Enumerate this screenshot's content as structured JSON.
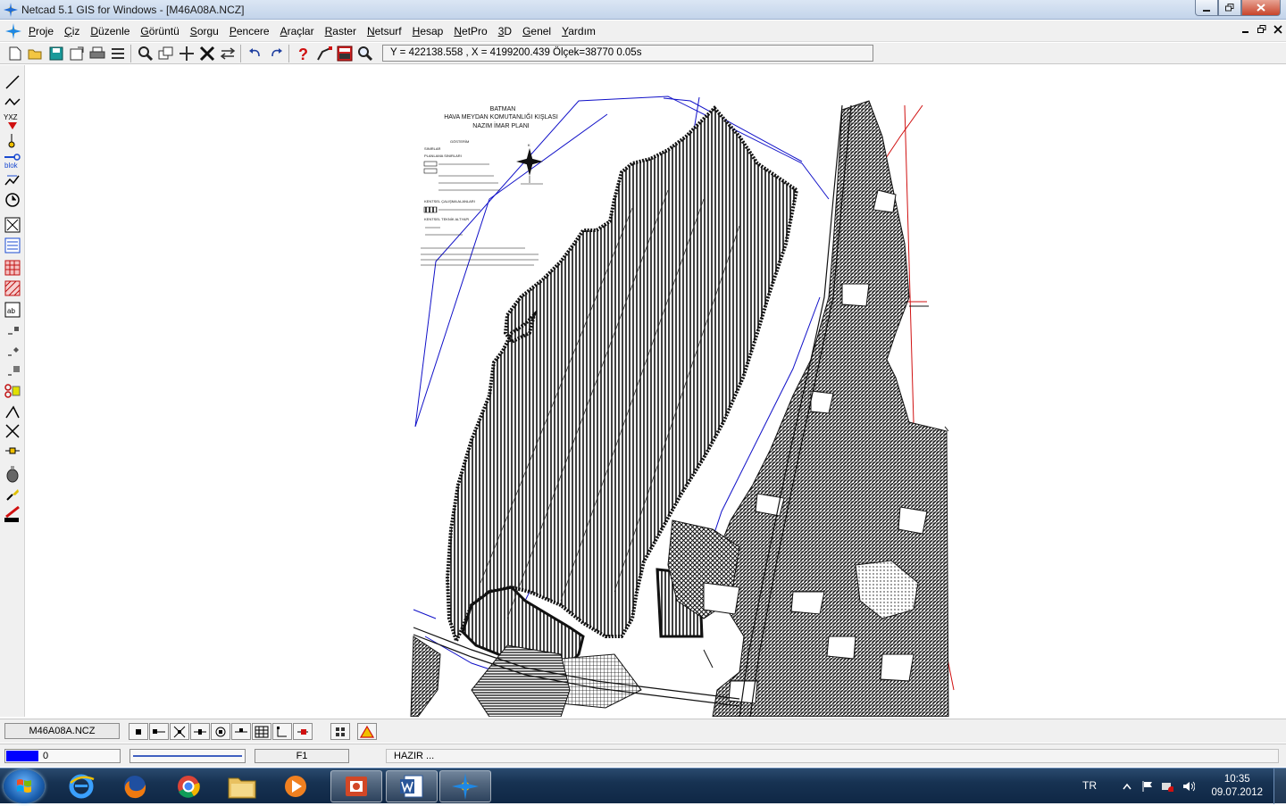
{
  "window": {
    "title": "Netcad 5.1 GIS for Windows - [M46A08A.NCZ]",
    "controls": [
      "minimize",
      "maximize",
      "close"
    ]
  },
  "menu": {
    "items": [
      "Proje",
      "Çiz",
      "Düzenle",
      "Görüntü",
      "Sorgu",
      "Pencere",
      "Araçlar",
      "Raster",
      "Netsurf",
      "Hesap",
      "NetPro",
      "3D",
      "Genel",
      "Yardım"
    ]
  },
  "toolbar": {
    "coordinates": "Y = 422138.558 , X = 4199200.439  Ölçek=38770   0.05s"
  },
  "left_toolbar": {
    "yxz_label": "YXZ",
    "blok_label": "blok",
    "ab_label": "ab"
  },
  "map": {
    "title_lines": [
      "BATMAN",
      "HAVA MEYDAN KOMUTANLIĞI KIŞLASI",
      "NAZIM İMAR PLANI"
    ],
    "legend_heading": "GÖSTERİM",
    "legend_items": [
      "SINIRLAR",
      "PLANLAMA SINIRLARI",
      "KENTSEL ÇALIŞMA ALANLARI",
      "KENTSEL TEKNİK ALTYAPI"
    ],
    "north_label": "K"
  },
  "statusbar": {
    "filename": "M46A08A.NCZ",
    "progress_value": "0",
    "function_key": "F1",
    "status_text": "HAZIR ..."
  },
  "taskbar": {
    "language": "TR",
    "time": "10:35",
    "date": "09.07.2012"
  }
}
